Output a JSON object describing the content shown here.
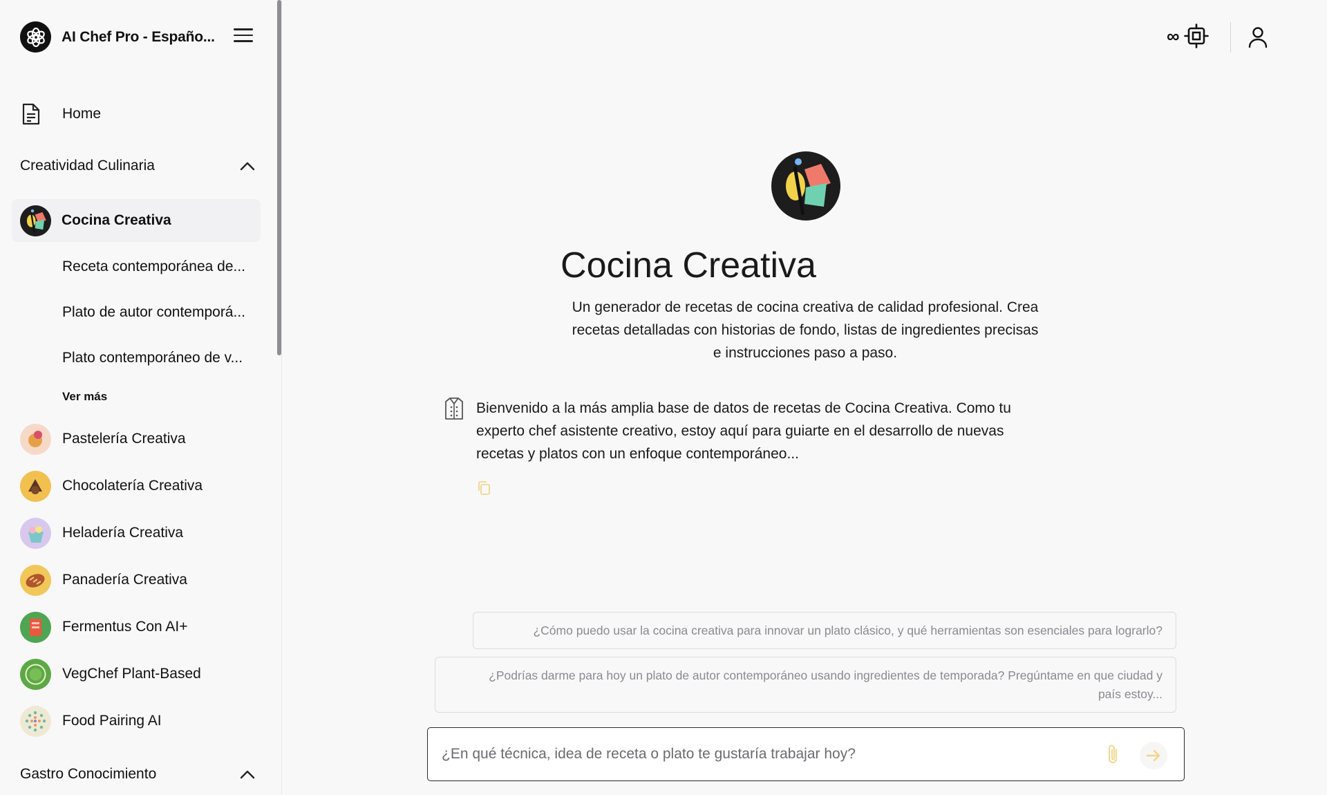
{
  "app": {
    "title": "AI Chef Pro - Españo..."
  },
  "sidebar": {
    "home_label": "Home",
    "section1": {
      "label": "Creatividad Culinaria",
      "active_item": "Cocina Creativa",
      "subitems": [
        "Receta contemporánea de...",
        "Plato de autor contemporá...",
        "Plato contemporáneo de v..."
      ],
      "more_label": "Ver más",
      "items": [
        {
          "label": "Pastelería Creativa",
          "icon": "pastry-avatar"
        },
        {
          "label": "Chocolatería Creativa",
          "icon": "chocolate-avatar"
        },
        {
          "label": "Heladería Creativa",
          "icon": "icecream-avatar"
        },
        {
          "label": "Panadería Creativa",
          "icon": "bread-avatar"
        },
        {
          "label": "Fermentus Con AI+",
          "icon": "fermentus-avatar"
        },
        {
          "label": "VegChef Plant-Based",
          "icon": "plant-based-avatar"
        },
        {
          "label": "Food Pairing AI",
          "icon": "food-pairing-avatar"
        }
      ]
    },
    "section2": {
      "label": "Gastro Conocimiento"
    }
  },
  "topbar": {
    "infinity": "∞"
  },
  "main": {
    "title": "Cocina Creativa",
    "description": "Un generador de recetas de cocina creativa de calidad profesional. Crea recetas detalladas con historias de fondo, listas de ingredientes precisas e instrucciones paso a paso.",
    "welcome": "Bienvenido a la más amplia base de datos de recetas de Cocina Creativa. Como tu experto chef asistente creativo, estoy aquí para guiarte en el desarrollo de nuevas recetas y platos con un enfoque contemporáneo...",
    "suggestions": [
      "¿Cómo puedo usar la cocina creativa para innovar un plato clásico, y qué herramientas son esenciales para lograrlo?",
      "¿Podrías darme para hoy un plato de autor contemporáneo usando ingredientes de temporada? Pregúntame en que ciudad y país estoy..."
    ],
    "input_placeholder": "¿En qué técnica, idea de receta o plato te gustaría trabajar hoy?"
  },
  "colors": {
    "background": "#f8f8f9",
    "accent_yellow": "#f2d58a",
    "border": "#dcdce0"
  }
}
